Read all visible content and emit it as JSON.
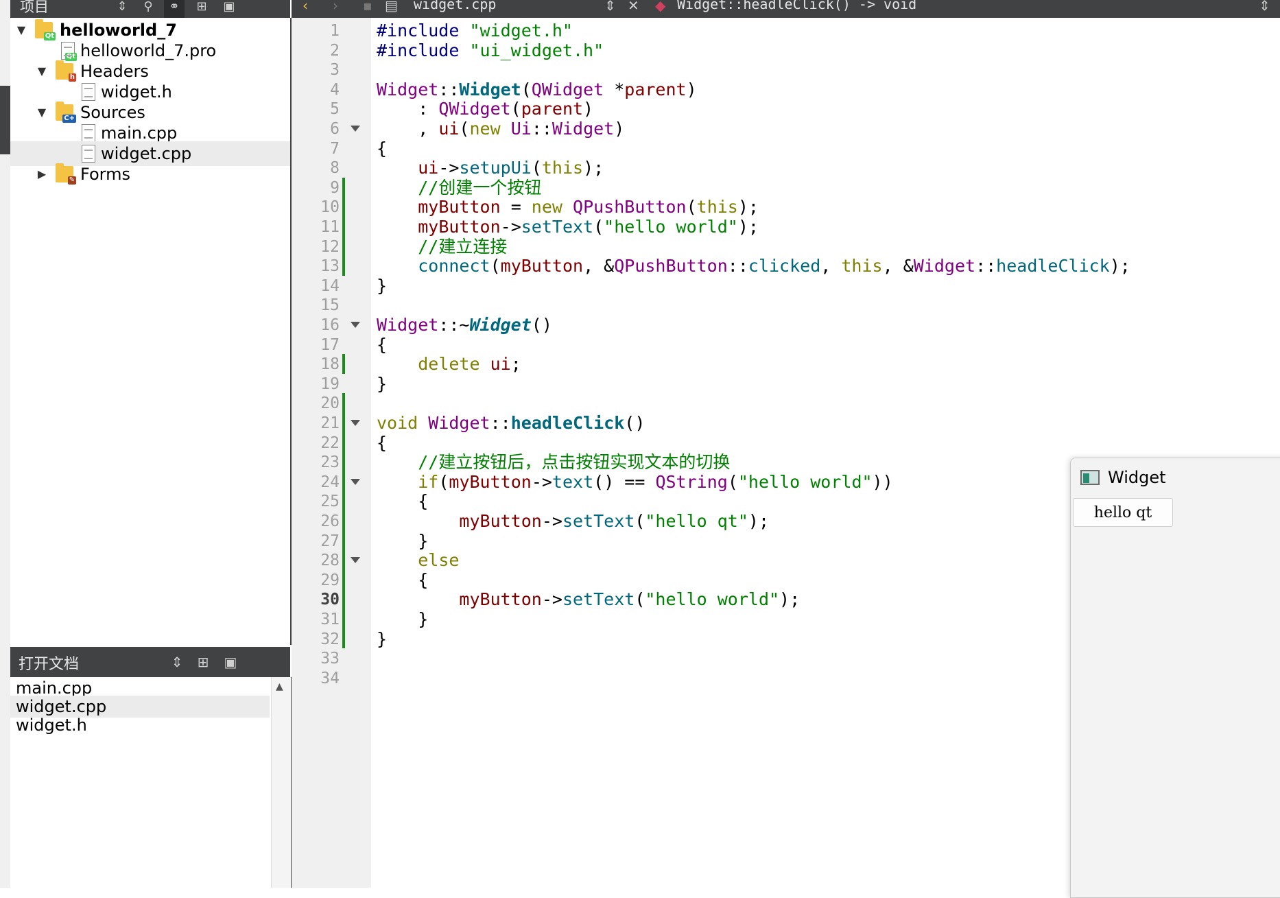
{
  "project_panel": {
    "title": "项目",
    "header_icons": [
      "dropdown-arrows-icon",
      "filter-icon",
      "link-icon",
      "split-add-icon",
      "close-pane-icon"
    ]
  },
  "project_tree": {
    "items": [
      {
        "label": "helloworld_7",
        "bold": true,
        "expanded": true,
        "icon": "qt-project-icon"
      },
      {
        "label": "helloworld_7.pro",
        "icon": "qt-pro-file-icon"
      },
      {
        "label": "Headers",
        "expanded": true,
        "icon": "headers-folder-icon"
      },
      {
        "label": "widget.h",
        "icon": "header-file-icon"
      },
      {
        "label": "Sources",
        "expanded": true,
        "icon": "sources-folder-icon"
      },
      {
        "label": "main.cpp",
        "icon": "cpp-file-icon"
      },
      {
        "label": "widget.cpp",
        "icon": "cpp-file-icon",
        "selected": true
      },
      {
        "label": "Forms",
        "expanded": false,
        "icon": "forms-folder-icon"
      }
    ]
  },
  "open_documents": {
    "title": "打开文档",
    "items": [
      {
        "label": "main.cpp"
      },
      {
        "label": "widget.cpp",
        "selected": true
      },
      {
        "label": "widget.h"
      }
    ]
  },
  "editor_toolbar": {
    "file_name": "widget.cpp",
    "function_signature": "Widget::headleClick() -> void"
  },
  "editor": {
    "current_line": 30,
    "line_numbers": [
      "1",
      "2",
      "3",
      "4",
      "5",
      "6",
      "7",
      "8",
      "9",
      "10",
      "11",
      "12",
      "13",
      "14",
      "15",
      "16",
      "17",
      "18",
      "19",
      "20",
      "21",
      "22",
      "23",
      "24",
      "25",
      "26",
      "27",
      "28",
      "29",
      "30",
      "31",
      "32",
      "33",
      "34"
    ],
    "lines": [
      "#include \"widget.h\"",
      "#include \"ui_widget.h\"",
      "",
      "Widget::Widget(QWidget *parent)",
      "    : QWidget(parent)",
      "    , ui(new Ui::Widget)",
      "{",
      "    ui->setupUi(this);",
      "    //创建一个按钮",
      "    myButton = new QPushButton(this);",
      "    myButton->setText(\"hello world\");",
      "    //建立连接",
      "    connect(myButton, &QPushButton::clicked, this, &Widget::headleClick);",
      "}",
      "",
      "Widget::~Widget()",
      "{",
      "    delete ui;",
      "}",
      "",
      "void Widget::headleClick()",
      "{",
      "    //建立按钮后，点击按钮实现文本的切换",
      "    if(myButton->text() == QString(\"hello world\"))",
      "    {",
      "        myButton->setText(\"hello qt\");",
      "    }",
      "    else",
      "    {",
      "        myButton->setText(\"hello world\");",
      "    }",
      "}",
      "",
      ""
    ]
  },
  "widget_window": {
    "title": "Widget",
    "button_label": "hello qt"
  },
  "colors": {
    "keyword": "#808000",
    "type": "#800080",
    "string": "#008000",
    "comment": "#008000",
    "function": "#00677c",
    "preprocessor": "#000080",
    "change_marker": "#1a8a1a"
  }
}
